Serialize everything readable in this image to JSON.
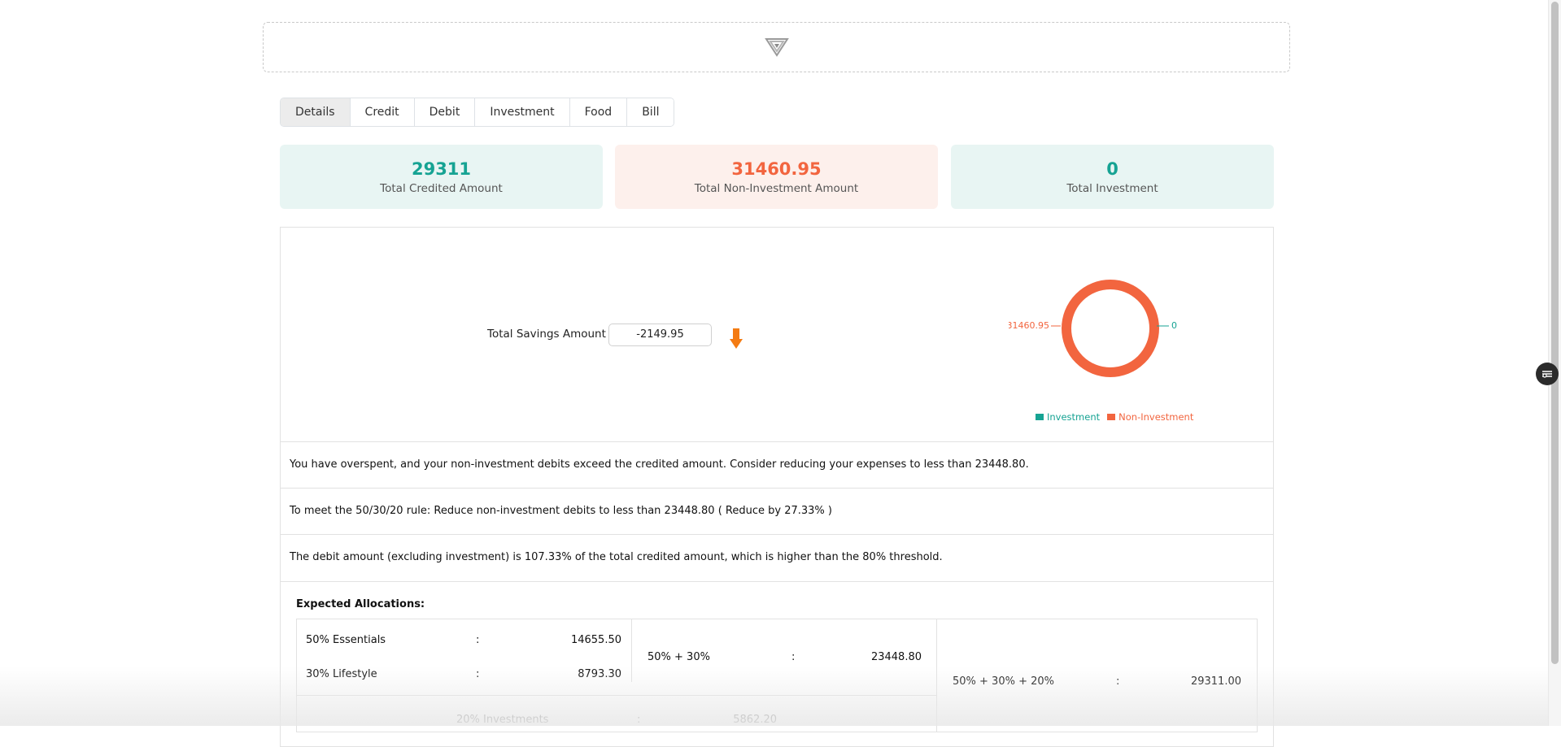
{
  "tabs": [
    {
      "label": "Details"
    },
    {
      "label": "Credit"
    },
    {
      "label": "Debit"
    },
    {
      "label": "Investment"
    },
    {
      "label": "Food"
    },
    {
      "label": "Bill"
    }
  ],
  "active_tab": "Details",
  "stats": {
    "credited": {
      "value": "29311",
      "label": "Total Credited Amount"
    },
    "non_investment": {
      "value": "31460.95",
      "label": "Total Non-Investment Amount"
    },
    "investment": {
      "value": "0",
      "label": "Total Investment"
    }
  },
  "savings": {
    "label": "Total Savings Amount :",
    "value": "-2149.95"
  },
  "chart_data": {
    "type": "pie",
    "categories": [
      "Investment",
      "Non-Investment"
    ],
    "values": [
      0,
      31460.95
    ],
    "labels": [
      "0",
      "31460.95"
    ],
    "legend": [
      "Investment",
      "Non-Investment"
    ],
    "legend_position": "bottom",
    "colors": [
      "#16a393",
      "#f2653f"
    ]
  },
  "messages": [
    "You have overspent, and your non-investment debits exceed the credited amount. Consider reducing your expenses to less than 23448.80.",
    "To meet the 50/30/20 rule: Reduce non-investment debits to less than 23448.80 ( Reduce by 27.33% )",
    "The debit amount (excluding investment) is 107.33% of the total credited amount, which is higher than the 80% threshold."
  ],
  "allocations": {
    "title": "Expected Allocations:",
    "essentials": {
      "label": "50% Essentials",
      "sep": ":",
      "value": "14655.50"
    },
    "lifestyle": {
      "label": "30% Lifestyle",
      "sep": ":",
      "value": "8793.30"
    },
    "investments": {
      "label": "20% Investments",
      "sep": ":",
      "value": "5862.20"
    },
    "fifty_thirty": {
      "label": "50% + 30%",
      "sep": ":",
      "value": "23448.80"
    },
    "total": {
      "label": "50% + 30% + 20%",
      "sep": ":",
      "value": "29311.00"
    }
  },
  "colors": {
    "teal": "#16a393",
    "orange": "#f2653f"
  },
  "icons": {
    "logo": "logo-icon",
    "arrow": "arrow-down-icon",
    "fab": "sliders-icon"
  }
}
